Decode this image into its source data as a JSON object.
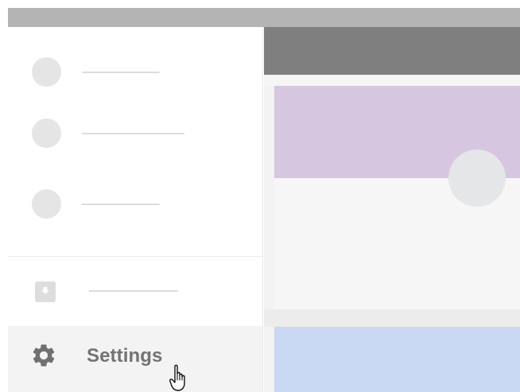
{
  "sidebar": {
    "settings_label": "Settings"
  },
  "icons": {
    "settings": "gear-icon",
    "download": "download-icon",
    "cursor": "hand-pointer-icon"
  },
  "colors": {
    "top_strip": "#b4b4b4",
    "header": "#7f7f7f",
    "purple_card": "#d7c6e0",
    "blue_card": "#c9d8f3",
    "settings_highlight": "#f3f3f3",
    "text_gray": "#737373"
  }
}
